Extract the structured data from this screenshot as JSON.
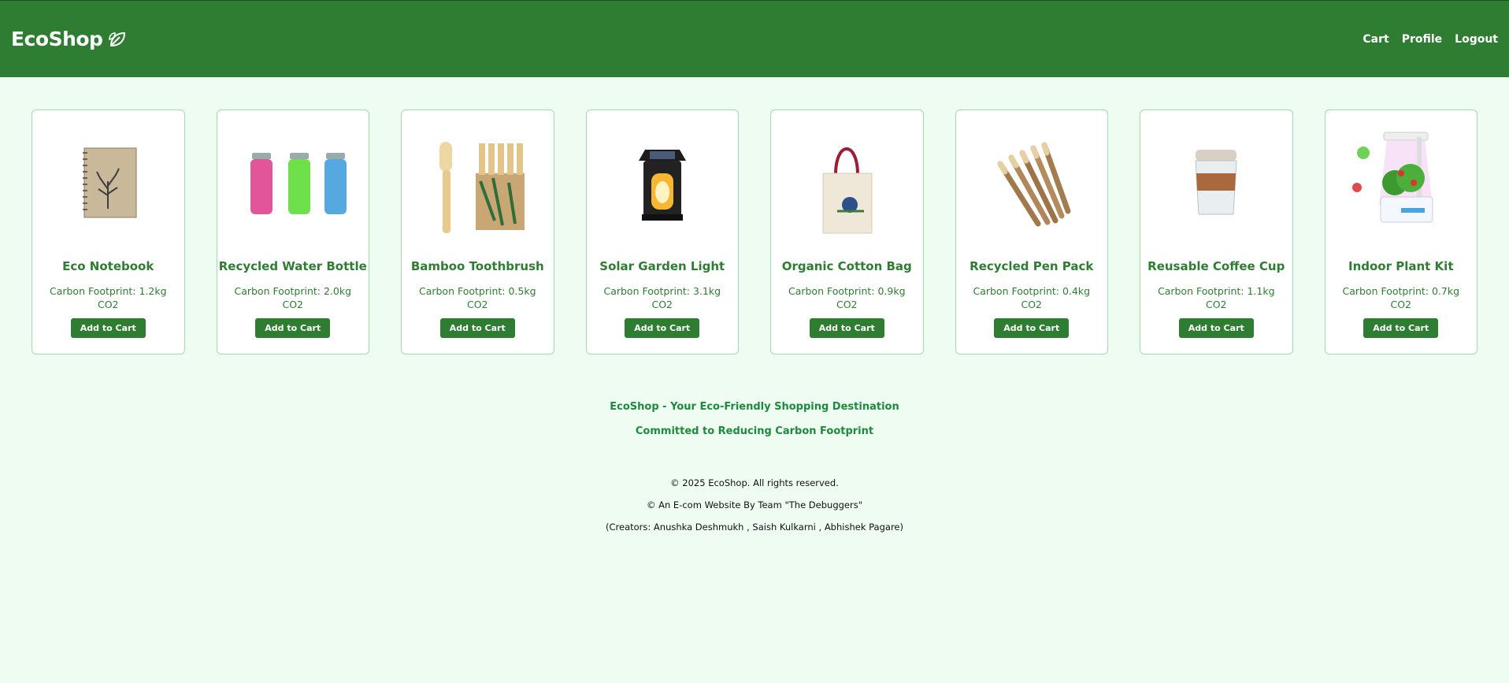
{
  "header": {
    "brand": "EcoShop",
    "brand_icon": "leaf-icon",
    "nav": [
      "Cart",
      "Profile",
      "Logout"
    ]
  },
  "products": [
    {
      "name": "Eco Notebook",
      "footprint": "Carbon Footprint: 1.2kg CO2",
      "button": "Add to Cart",
      "icon": "notebook"
    },
    {
      "name": "Recycled Water Bottle",
      "footprint": "Carbon Footprint: 2.0kg CO2",
      "button": "Add to Cart",
      "icon": "bottles"
    },
    {
      "name": "Bamboo Toothbrush",
      "footprint": "Carbon Footprint: 0.5kg CO2",
      "button": "Add to Cart",
      "icon": "toothbrush"
    },
    {
      "name": "Solar Garden Light",
      "footprint": "Carbon Footprint: 3.1kg CO2",
      "button": "Add to Cart",
      "icon": "lantern"
    },
    {
      "name": "Organic Cotton Bag",
      "footprint": "Carbon Footprint: 0.9kg CO2",
      "button": "Add to Cart",
      "icon": "tote-bag"
    },
    {
      "name": "Recycled Pen Pack",
      "footprint": "Carbon Footprint: 0.4kg CO2",
      "button": "Add to Cart",
      "icon": "pens"
    },
    {
      "name": "Reusable Coffee Cup",
      "footprint": "Carbon Footprint: 1.1kg CO2",
      "button": "Add to Cart",
      "icon": "coffee-cup"
    },
    {
      "name": "Indoor Plant Kit",
      "footprint": "Carbon Footprint: 0.7kg CO2",
      "button": "Add to Cart",
      "icon": "plant-kit"
    }
  ],
  "footer": {
    "tagline1": "EcoShop - Your Eco-Friendly Shopping Destination",
    "tagline2": "Committed to Reducing Carbon Footprint",
    "copyright": "© 2025 EcoShop. All rights reserved.",
    "team": "© An E-com Website By Team \"The Debuggers\"",
    "creators": "(Creators: Anushka Deshmukh , Saish Kulkarni , Abhishek Pagare)"
  },
  "colors": {
    "primary": "#2e7d32",
    "background": "#eefcf1",
    "tagline": "#1e8a3c"
  }
}
